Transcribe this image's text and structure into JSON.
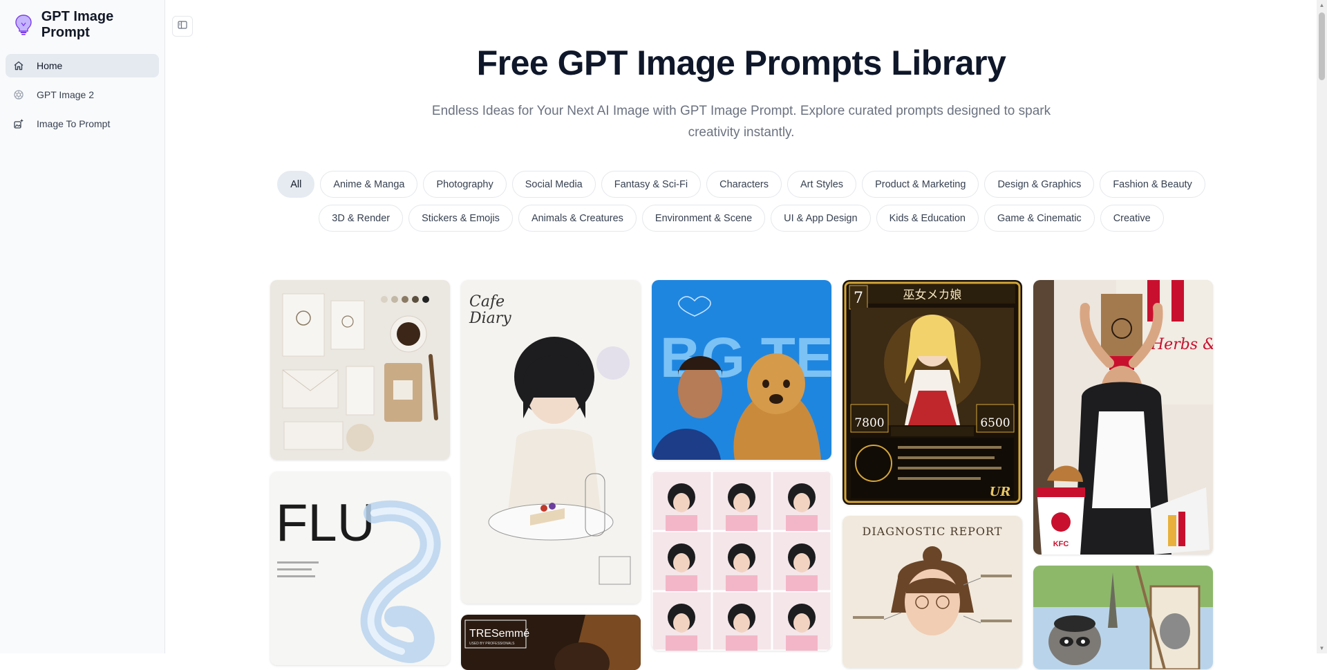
{
  "brand": {
    "name": "GPT Image Prompt",
    "logo_icon": "lightbulb-icon"
  },
  "sidebar": {
    "items": [
      {
        "label": "Home",
        "icon": "home-icon",
        "active": true
      },
      {
        "label": "GPT Image 2",
        "icon": "openai-icon",
        "active": false
      },
      {
        "label": "Image To Prompt",
        "icon": "image-sparkle-icon",
        "active": false
      }
    ]
  },
  "hero": {
    "title": "Free GPT Image Prompts Library",
    "subtitle": "Endless Ideas for Your Next AI Image with GPT Image Prompt. Explore curated prompts designed to spark creativity instantly."
  },
  "categories": {
    "row1": [
      "All",
      "Anime & Manga",
      "Photography",
      "Social Media",
      "Fantasy & Sci-Fi",
      "Characters",
      "Art Styles",
      "Product & Marketing",
      "Design & Graphics",
      "Fashion & Beauty"
    ],
    "row2": [
      "3D & Render",
      "Stickers & Emojis",
      "Animals & Creatures",
      "Environment & Scene",
      "UI & App Design",
      "Kids & Education",
      "Game & Cinematic",
      "Creative"
    ],
    "active": "All"
  },
  "gallery": {
    "cafe": {
      "title": "Cafe",
      "subtitle": "Diary"
    },
    "flu": {
      "text": "FLU"
    },
    "bgtext": {
      "text": "BG TEXT"
    },
    "card_game": {
      "title": "巫女メカ娘",
      "level": "7",
      "attack": "7800",
      "hp": "6500",
      "rarity": "UR"
    },
    "diagnostic": {
      "title": "DIAGNOSTIC REPORT"
    },
    "tresemme": {
      "brand": "TRESemmé",
      "tagline": "USED BY PROFESSIONALS"
    },
    "kfc": {
      "logo": "KFC",
      "sign": "Herbs & Sp"
    }
  },
  "colors": {
    "accent": "#0f172a",
    "chip_active": "#e6ebf2",
    "sidebar_bg": "#f9fafb"
  }
}
